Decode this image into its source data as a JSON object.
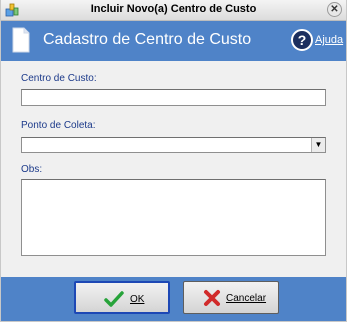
{
  "window": {
    "title": "Incluir Novo(a) Centro de Custo"
  },
  "header": {
    "title": "Cadastro de Centro de Custo",
    "help_label": "Ajuda"
  },
  "form": {
    "centro_label": "Centro de Custo:",
    "centro_value": "",
    "coleta_label": "Ponto de Coleta:",
    "coleta_value": "",
    "obs_label": "Obs:",
    "obs_value": ""
  },
  "buttons": {
    "ok_label": "OK",
    "cancel_label": "Cancelar"
  },
  "colors": {
    "header_blue": "#4f83c8",
    "label_blue": "#1c3a8a",
    "ok_check_green": "#27a33a",
    "cancel_x_red": "#d12b2b"
  },
  "icons": {
    "title": "app-tool-icon",
    "close": "close-icon",
    "document": "document-icon",
    "help": "question-icon",
    "ok": "check-icon",
    "cancel": "x-icon"
  }
}
